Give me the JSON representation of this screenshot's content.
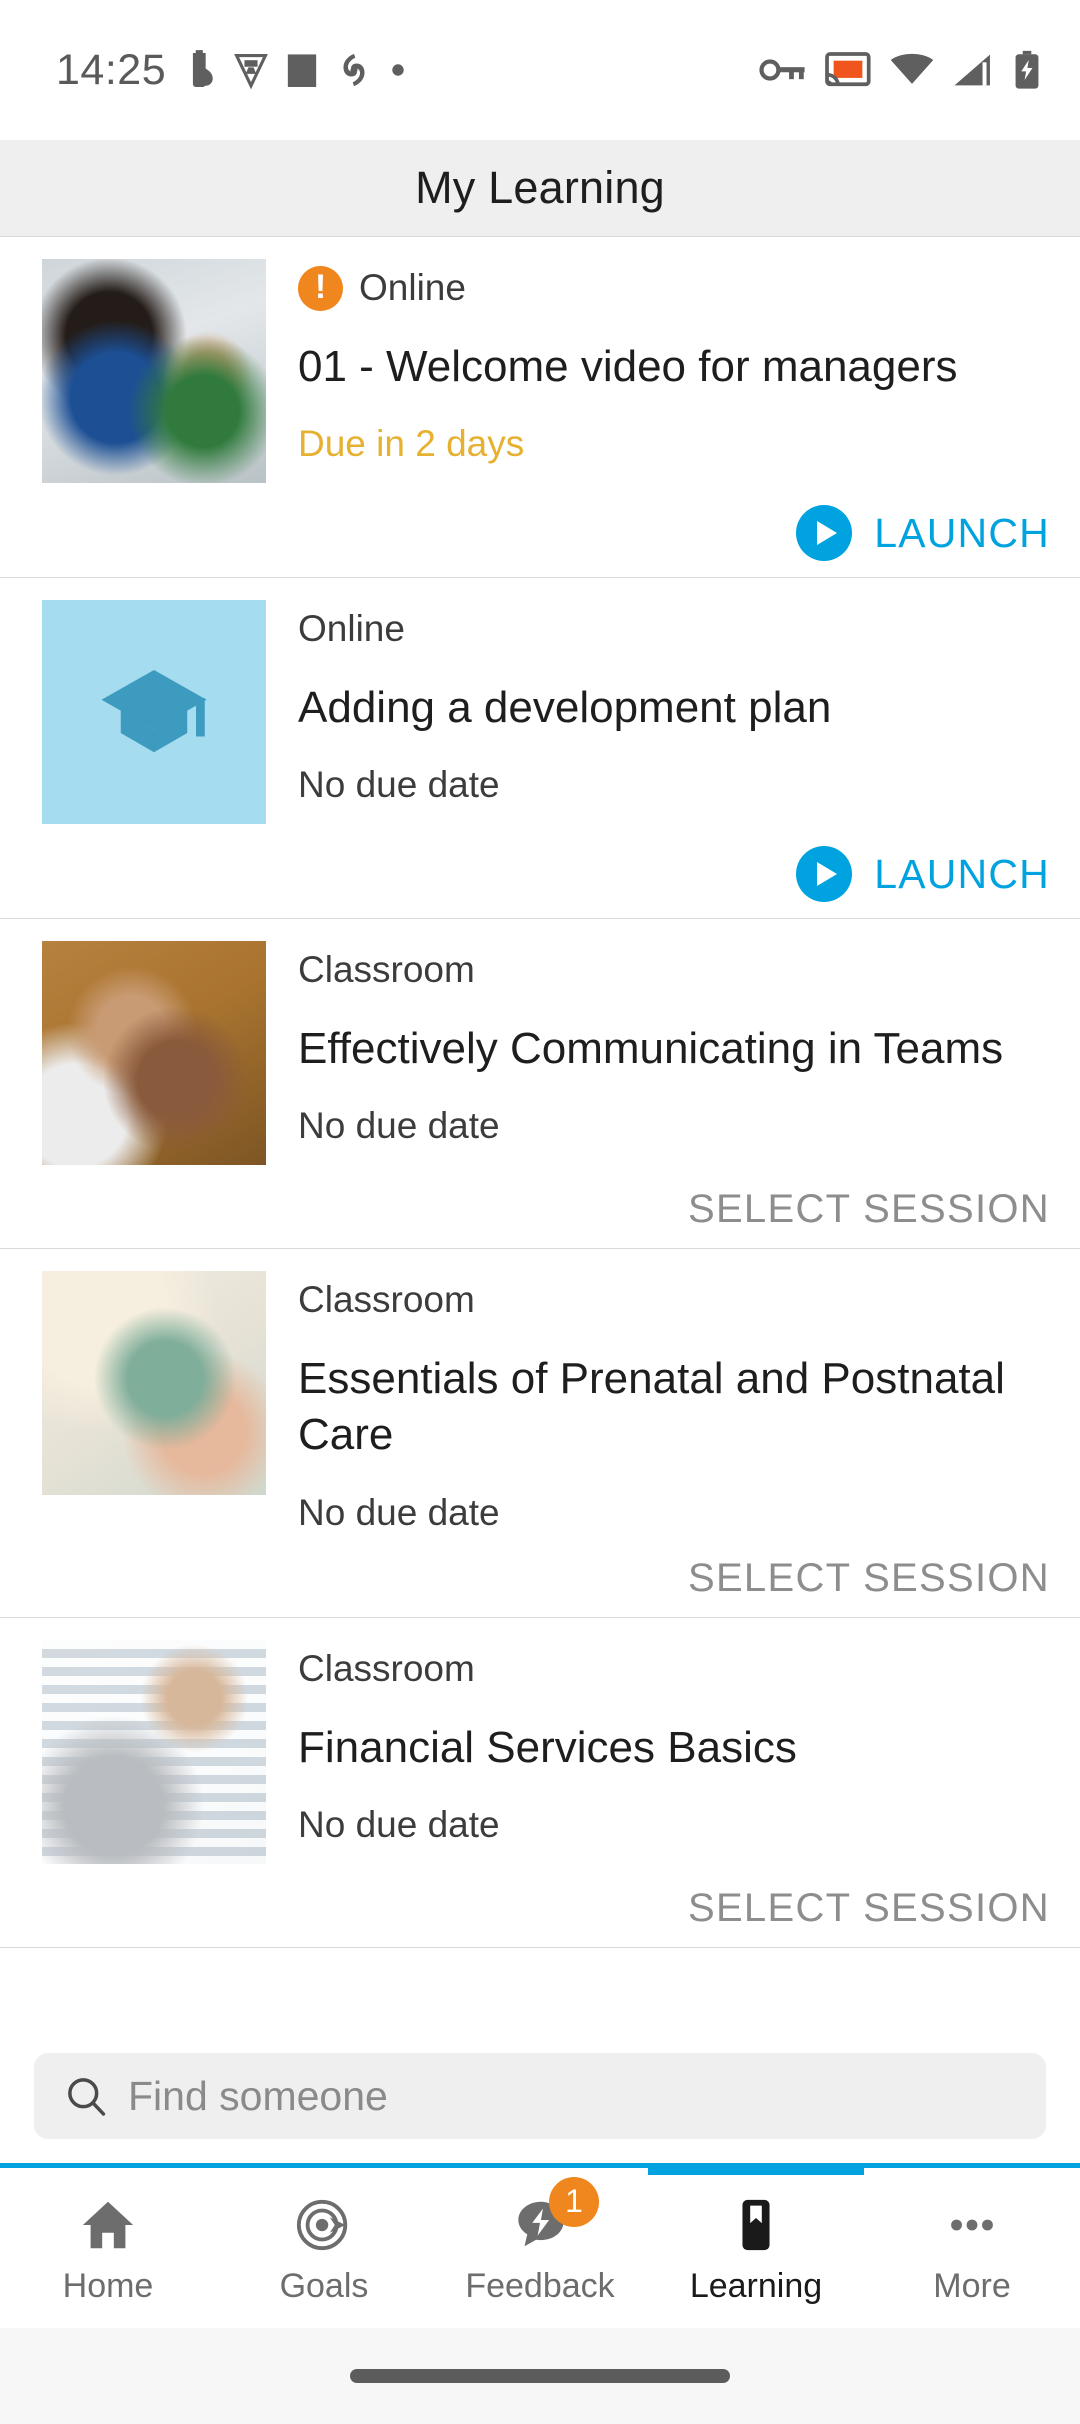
{
  "status_bar": {
    "time": "14:25",
    "left_icons": [
      "battery-saver-icon",
      "shield-icon",
      "square-icon",
      "sync-icon",
      "dot-icon"
    ],
    "right_icons": [
      "vpn-key-icon",
      "cast-icon",
      "wifi-icon",
      "signal-icon",
      "battery-charging-icon"
    ],
    "accent_cast": "#F0551E"
  },
  "header": {
    "title": "My Learning"
  },
  "colors": {
    "accent_blue": "#00A3E0",
    "alert_orange": "#F0871E",
    "due_warning": "#E6B131",
    "muted_gray": "#8D8D8D",
    "placeholder_bg": "#A5DCF0",
    "placeholder_icon": "#3D9BBF"
  },
  "courses": [
    {
      "type": "Online",
      "title": "01 - Welcome video for managers",
      "due": "Due in 2 days",
      "due_warning": true,
      "has_alert": true,
      "action": "LAUNCH",
      "action_type": "launch",
      "thumb": "photo-two-people-laptop"
    },
    {
      "type": "Online",
      "title": "Adding a development plan",
      "due": "No due date",
      "due_warning": false,
      "has_alert": false,
      "action": "LAUNCH",
      "action_type": "launch",
      "thumb": "graduation-cap-placeholder"
    },
    {
      "type": "Classroom",
      "title": "Effectively Communicating in Teams",
      "due": "No due date",
      "due_warning": false,
      "has_alert": false,
      "action": "SELECT SESSION",
      "action_type": "select",
      "thumb": "photo-hands-fist-bump"
    },
    {
      "type": "Classroom",
      "title": "Essentials of Prenatal and Postnatal Care",
      "due": "No due date",
      "due_warning": false,
      "has_alert": false,
      "action": "SELECT SESSION",
      "action_type": "select",
      "thumb": "photo-clipboard-nurse"
    },
    {
      "type": "Classroom",
      "title": "Financial Services Basics",
      "due": "No due date",
      "due_warning": false,
      "has_alert": false,
      "action": "SELECT SESSION",
      "action_type": "select",
      "thumb": "photo-man-laptop-window"
    }
  ],
  "search": {
    "placeholder": "Find someone",
    "value": "",
    "icon": "search-icon"
  },
  "bottom_nav": {
    "active_index": 3,
    "items": [
      {
        "label": "Home",
        "icon": "home-icon",
        "badge": null
      },
      {
        "label": "Goals",
        "icon": "target-icon",
        "badge": null
      },
      {
        "label": "Feedback",
        "icon": "feedback-icon",
        "badge": "1"
      },
      {
        "label": "Learning",
        "icon": "bookmark-icon",
        "badge": null
      },
      {
        "label": "More",
        "icon": "more-dots-icon",
        "badge": null
      }
    ]
  }
}
